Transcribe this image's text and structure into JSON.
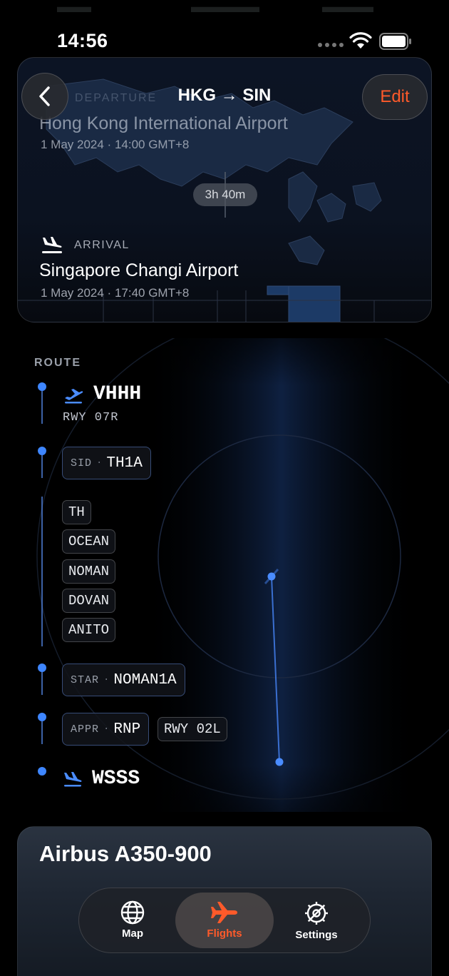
{
  "status_bar": {
    "time": "14:56"
  },
  "nav": {
    "title": "HKG → SIN",
    "edit_label": "Edit"
  },
  "departure": {
    "label": "DEPARTURE",
    "airport": "Hong Kong International Airport",
    "time": "1 May 2024 · 14:00 GMT+8"
  },
  "duration": "3h 40m",
  "arrival": {
    "label": "ARRIVAL",
    "airport": "Singapore Changi Airport",
    "time": "1 May 2024 · 17:40 GMT+8"
  },
  "route": {
    "label": "ROUTE",
    "origin": {
      "code": "VHHH",
      "runway": "RWY 07R"
    },
    "sid": {
      "key": "SID",
      "value": "TH1A"
    },
    "waypoints": [
      "TH",
      "OCEAN",
      "NOMAN",
      "DOVAN",
      "ANITO"
    ],
    "star": {
      "key": "STAR",
      "value": "NOMAN1A"
    },
    "approach": {
      "key": "APPR",
      "value": "RNP",
      "runway": "RWY 02L"
    },
    "destination": {
      "code": "WSSS"
    }
  },
  "aircraft": {
    "name": "Airbus A350-900"
  },
  "tabs": [
    {
      "label": "Map",
      "icon": "globe-icon",
      "active": false
    },
    {
      "label": "Flights",
      "icon": "airplane-icon",
      "active": true
    },
    {
      "label": "Settings",
      "icon": "gear-icon",
      "active": false
    }
  ],
  "colors": {
    "accent": "#ff5a2a",
    "route_blue": "#3e86ff",
    "background": "#000000"
  }
}
